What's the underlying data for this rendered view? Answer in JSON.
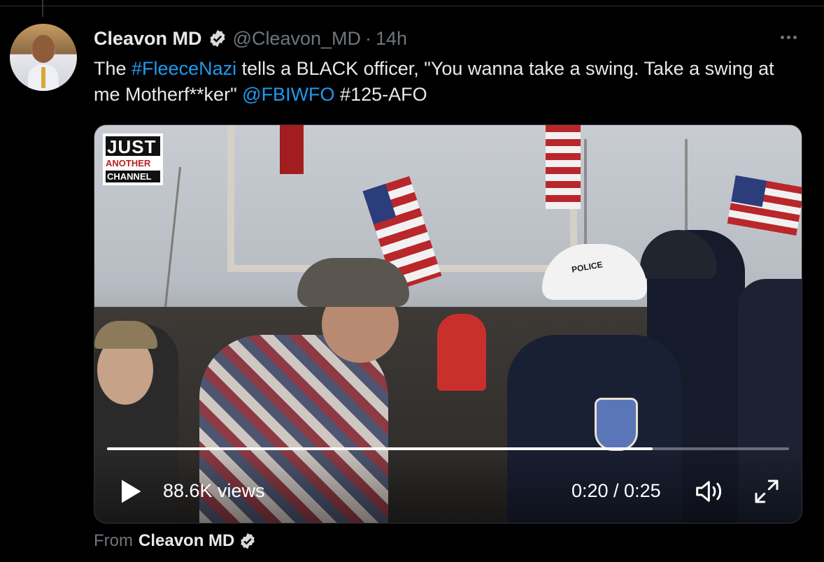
{
  "tweet": {
    "author_name": "Cleavon MD",
    "author_handle": "@Cleavon_MD",
    "separator": "·",
    "time": "14h",
    "text_parts": {
      "t1": "The ",
      "hashtag1": "#FleeceNazi",
      "t2": " tells a BLACK officer, \"You wanna take a swing. Take a swing at me Motherf**ker\" ",
      "mention": "@FBIWFO",
      "t3": " #125-AFO"
    }
  },
  "video": {
    "watermark": {
      "line1": "JUST",
      "line2": "ANOTHER",
      "line3": "CHANNEL"
    },
    "helmet_label": "POLICE",
    "views": "88.6K views",
    "time": "0:20 / 0:25",
    "progress": 0.8
  },
  "source": {
    "label": "From",
    "name": "Cleavon MD"
  },
  "icons": {
    "verified": "verified-badge-icon",
    "more": "more-icon",
    "play": "play-icon",
    "volume": "volume-icon",
    "fullscreen": "fullscreen-icon"
  },
  "colors": {
    "link": "#1d9bf0",
    "muted": "#6e767d",
    "text": "#e7e9ea",
    "background": "#000000"
  }
}
